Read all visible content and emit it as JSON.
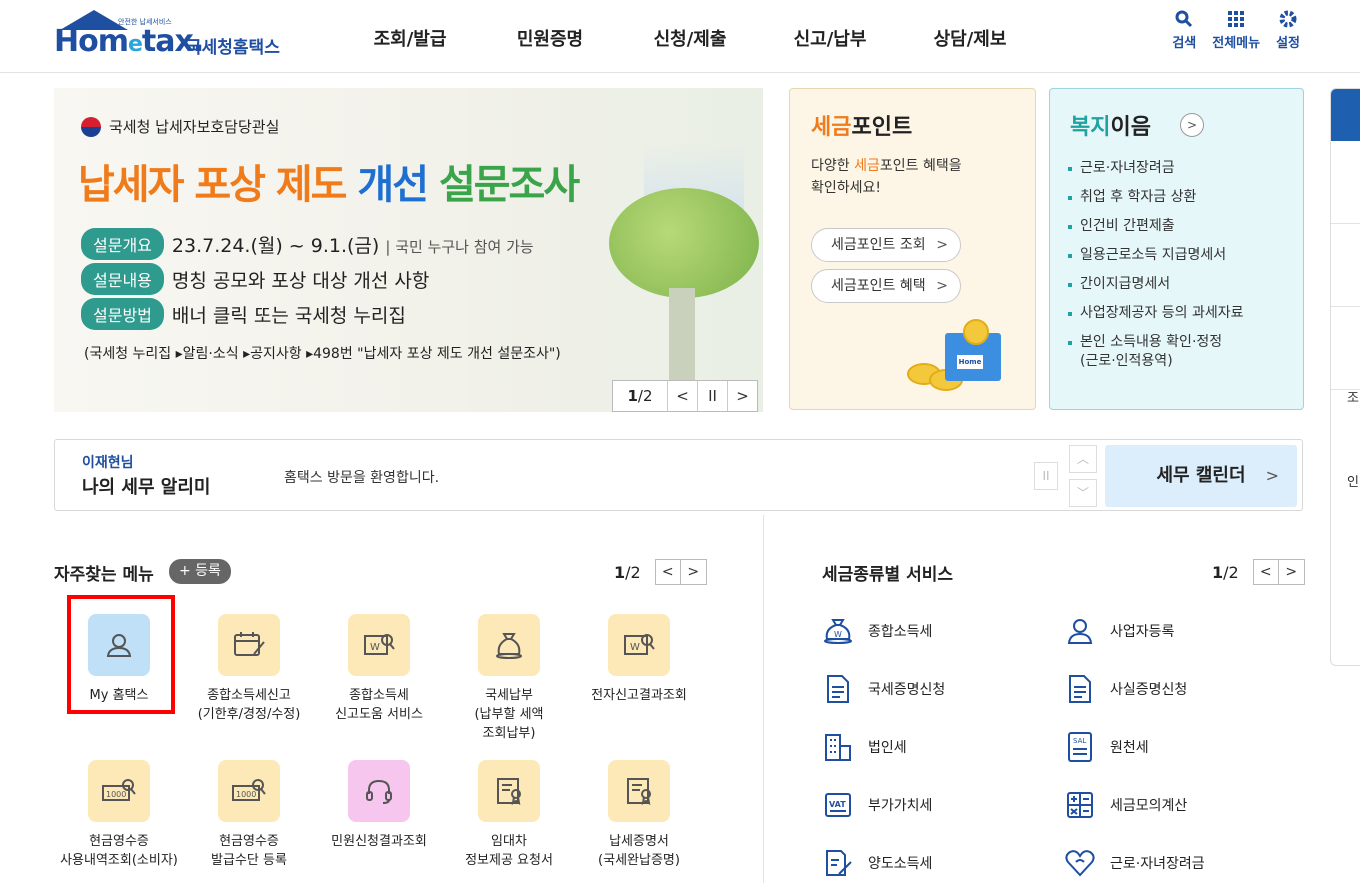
{
  "header": {
    "logo_small": "안전한 납세서비스",
    "logo_main_1": "Hom",
    "logo_main_e": "e",
    "logo_main_2": "tax.",
    "logo_sub": "국세청홈택스",
    "nav": [
      "조회/발급",
      "민원증명",
      "신청/제출",
      "신고/납부",
      "상담/제보"
    ],
    "util": [
      {
        "label": "검색",
        "icon": "search-icon"
      },
      {
        "label": "전체메뉴",
        "icon": "grid-icon"
      },
      {
        "label": "설정",
        "icon": "gear-icon"
      }
    ]
  },
  "banner": {
    "org": "국세청 납세자보호담당관실",
    "title_1": "납세자 포상 제도",
    "title_2": "개선",
    "title_3": "설문조사",
    "rows": [
      {
        "tag": "설문개요",
        "text": "23.7.24.(월) ~ 9.1.(금)",
        "sub": "| 국민 누구나 참여 가능"
      },
      {
        "tag": "설문내용",
        "text": "명칭 공모와 포상 대상 개선 사항",
        "sub": ""
      },
      {
        "tag": "설문방법",
        "text": "배너 클릭 또는 국세청 누리집",
        "sub": ""
      }
    ],
    "note": "(국세청 누리집 ▸알림·소식 ▸공지사항 ▸498번 \"납세자 포상 제도 개선 설문조사\")",
    "page_current": "1",
    "page_total": "/2",
    "prev": "<",
    "pause": "II",
    "next": ">"
  },
  "tax_point": {
    "title_hl": "세금",
    "title_rest": "포인트",
    "desc_1": "다양한 ",
    "desc_hl": "세금",
    "desc_2": "포인트 혜택을",
    "desc_3": "확인하세요!",
    "btn_view": "세금포인트 조회",
    "btn_benefit": "세금포인트 혜택",
    "arrow": ">",
    "box_label": "Home"
  },
  "welfare": {
    "title_hl": "복지",
    "title_rest": "이음",
    "more": ">",
    "items": [
      "근로·자녀장려금",
      "취업 후 학자금 상환",
      "인건비 간편제출",
      "일용근로소득 지급명세서",
      "간이지급명세서",
      "사업장제공자 등의 과세자료",
      "본인 소득내용 확인·정정",
      "(근로·인적용역)"
    ]
  },
  "side": {
    "txt_1": "조",
    "txt_2": "인"
  },
  "alarm": {
    "user": "이재현님",
    "title": "나의 세무 알리미",
    "message": "홈택스 방문을 환영합니다.",
    "pause": "II",
    "up": "︿",
    "down": "﹀",
    "calendar": "세무 캘린더",
    "calendar_arrow": ">"
  },
  "favorites": {
    "title": "자주찾는 메뉴",
    "add": "+ 등록",
    "page": "1",
    "page_total": "/2",
    "prev": "<",
    "next": ">",
    "items": [
      {
        "label_1": "My 홈택스",
        "label_2": "",
        "label_3": "",
        "icon": "user-icon"
      },
      {
        "label_1": "종합소득세신고",
        "label_2": "(기한후/경정/수정)",
        "label_3": "",
        "icon": "calendar-edit-icon"
      },
      {
        "label_1": "종합소득세",
        "label_2": "신고도움 서비스",
        "label_3": "",
        "icon": "document-search-icon"
      },
      {
        "label_1": "국세납부",
        "label_2": "(납부할 세액",
        "label_3": "조회납부)",
        "icon": "money-bag-icon"
      },
      {
        "label_1": "전자신고결과조회",
        "label_2": "",
        "label_3": "",
        "icon": "document-search-icon"
      },
      {
        "label_1": "현금영수증",
        "label_2": "사용내역조회(소비자)",
        "label_3": "",
        "icon": "receipt-search-icon"
      },
      {
        "label_1": "현금영수증",
        "label_2": "발급수단 등록",
        "label_3": "",
        "icon": "receipt-search-icon"
      },
      {
        "label_1": "민원신청결과조회",
        "label_2": "",
        "label_3": "",
        "icon": "headset-icon"
      },
      {
        "label_1": "임대차",
        "label_2": "정보제공 요청서",
        "label_3": "",
        "icon": "certificate-icon"
      },
      {
        "label_1": "납세증명서",
        "label_2": "(국세완납증명)",
        "label_3": "",
        "icon": "certificate-icon"
      }
    ]
  },
  "tax_services": {
    "title": "세금종류별 서비스",
    "page": "1",
    "page_total": "/2",
    "prev": "<",
    "next": ">",
    "items": [
      {
        "label": "종합소득세",
        "icon": "money-bag-icon"
      },
      {
        "label": "사업자등록",
        "icon": "user-icon"
      },
      {
        "label": "국세증명신청",
        "icon": "document-icon"
      },
      {
        "label": "사실증명신청",
        "icon": "document-icon"
      },
      {
        "label": "법인세",
        "icon": "building-icon"
      },
      {
        "label": "원천세",
        "icon": "salary-icon"
      },
      {
        "label": "부가가치세",
        "icon": "vat-icon"
      },
      {
        "label": "세금모의계산",
        "icon": "calculator-icon"
      },
      {
        "label": "양도소득세",
        "icon": "document-edit-icon"
      },
      {
        "label": "근로·자녀장려금",
        "icon": "heart-icon"
      }
    ]
  },
  "colors": {
    "brand": "#1f4fa0",
    "orange": "#ef7b1a",
    "teal": "#1fa3a0",
    "highlight": "#ff0000"
  }
}
